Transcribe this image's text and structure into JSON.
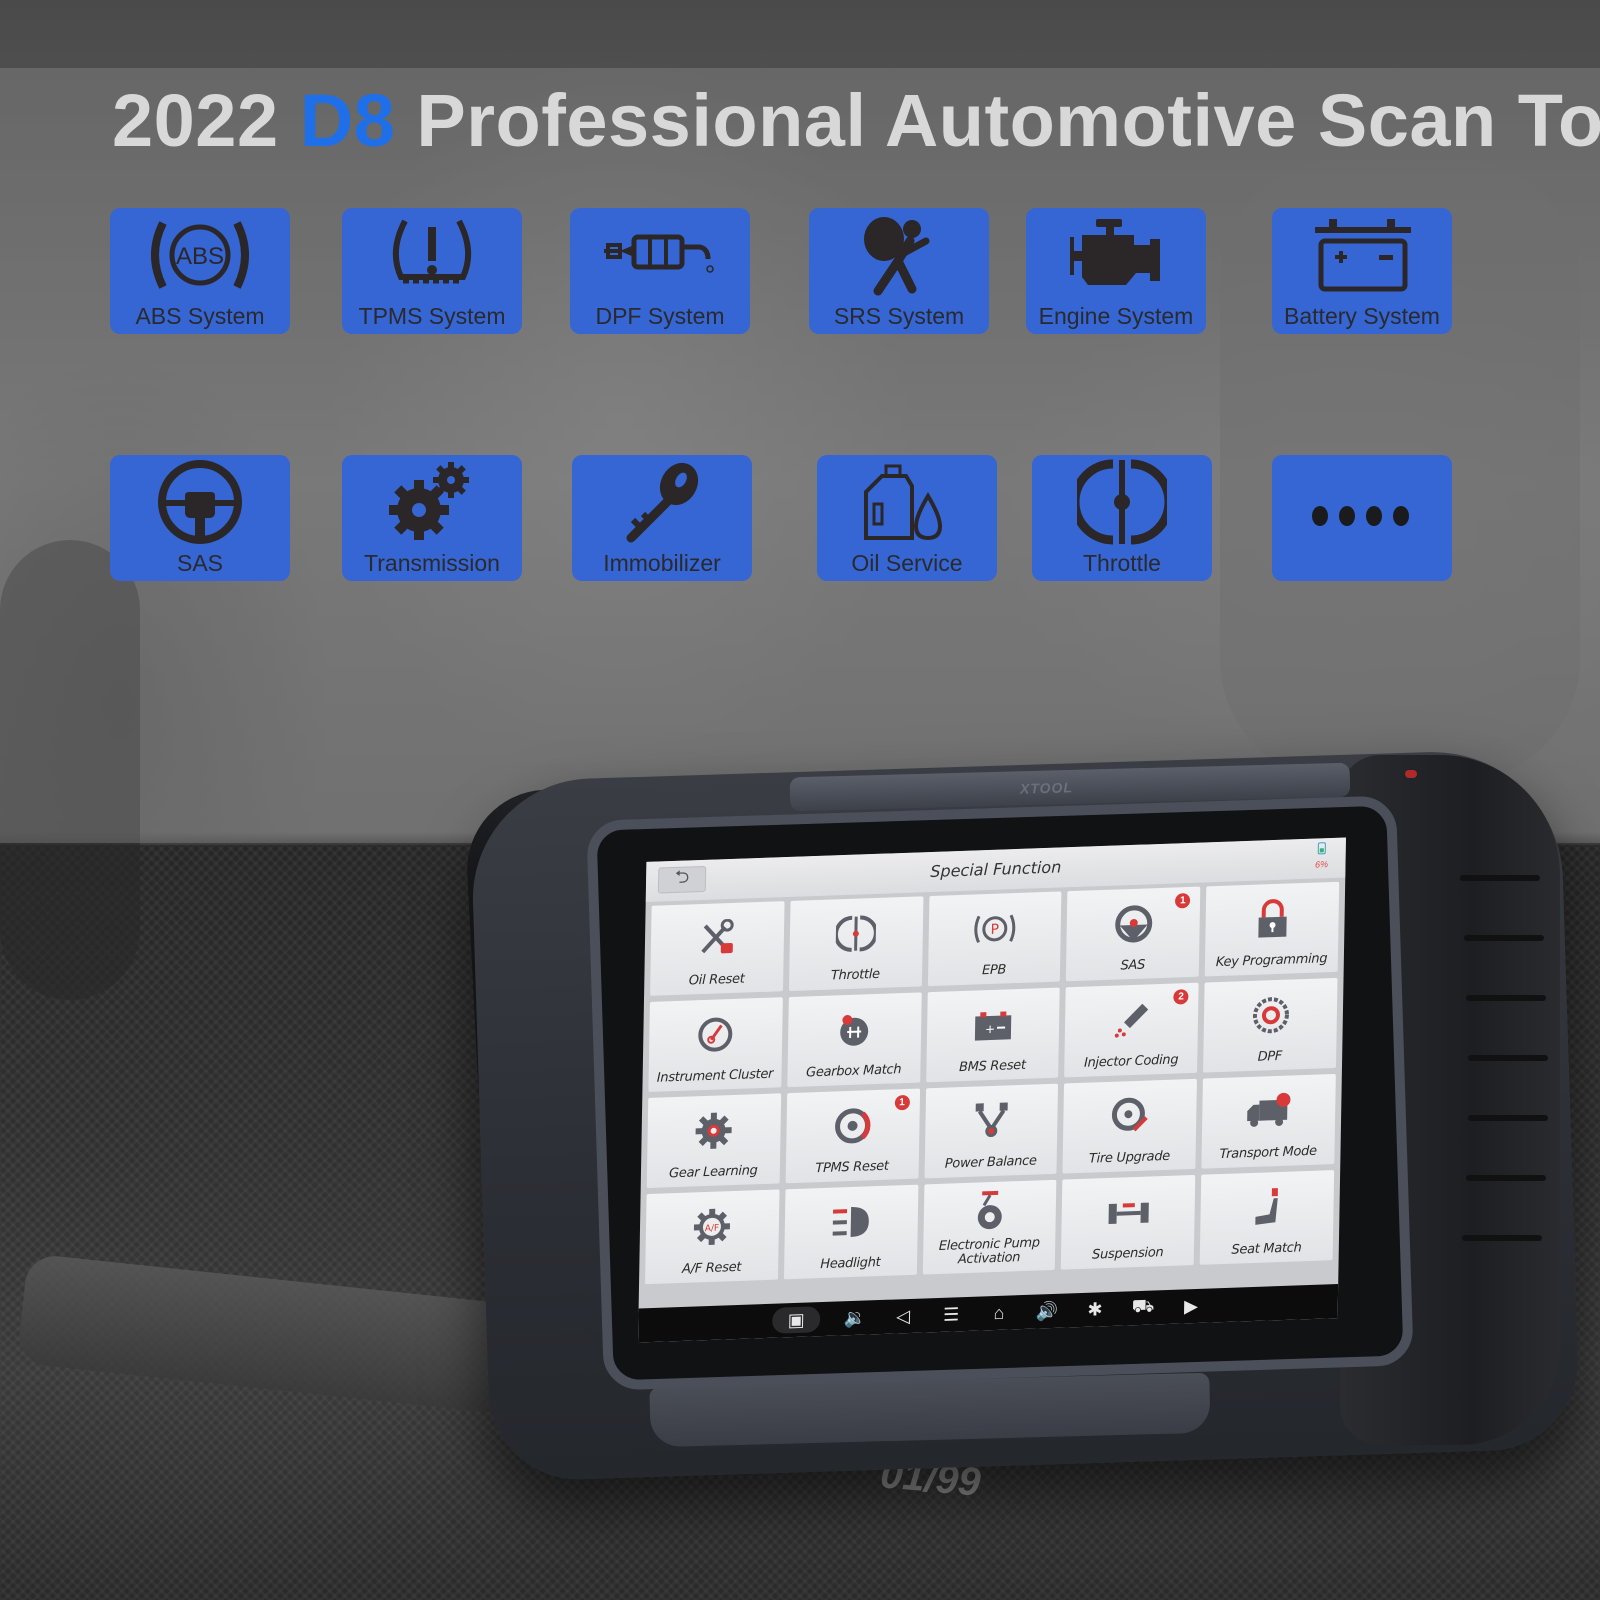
{
  "headline": {
    "year": "2022",
    "model": "D8",
    "rest": "Professional Automotive Scan Tool",
    "accent_color": "#1f6fe8",
    "text_color": "#d8d8d8"
  },
  "feature_tiles": {
    "tile_color": "#3566d3",
    "icon_color": "#2b2627",
    "row1": [
      {
        "label": "ABS System",
        "icon": "abs-icon"
      },
      {
        "label": "TPMS System",
        "icon": "tpms-icon"
      },
      {
        "label": "DPF System",
        "icon": "dpf-icon"
      },
      {
        "label": "SRS System",
        "icon": "airbag-icon"
      },
      {
        "label": "Engine System",
        "icon": "engine-icon"
      },
      {
        "label": "Battery System",
        "icon": "battery-icon"
      }
    ],
    "row2": [
      {
        "label": "SAS",
        "icon": "steering-wheel-icon"
      },
      {
        "label": "Transmission",
        "icon": "gears-icon"
      },
      {
        "label": "Immobilizer",
        "icon": "key-icon"
      },
      {
        "label": "Oil Service",
        "icon": "oil-can-icon"
      },
      {
        "label": "Throttle",
        "icon": "throttle-icon"
      },
      {
        "label": "",
        "icon": "more-dots-icon"
      }
    ]
  },
  "device": {
    "brand": "XTOOL",
    "sill_badge": "01/99",
    "screen": {
      "title": "Special Function",
      "back_icon": "back-arrow-icon",
      "battery_percent": "6%",
      "functions": [
        {
          "label": "Oil Reset",
          "icon": "wrench-icon",
          "badge": ""
        },
        {
          "label": "Throttle",
          "icon": "throttle-icon",
          "badge": ""
        },
        {
          "label": "EPB",
          "icon": "parking-brake-icon",
          "badge": ""
        },
        {
          "label": "SAS",
          "icon": "steering-wheel-icon",
          "badge": "1"
        },
        {
          "label": "Key Programming",
          "icon": "lock-icon",
          "badge": ""
        },
        {
          "label": "Instrument Cluster",
          "icon": "gauge-icon",
          "badge": ""
        },
        {
          "label": "Gearbox Match",
          "icon": "gear-shift-icon",
          "badge": ""
        },
        {
          "label": "BMS Reset",
          "icon": "battery-icon",
          "badge": ""
        },
        {
          "label": "Injector Coding",
          "icon": "injector-icon",
          "badge": "2"
        },
        {
          "label": "DPF",
          "icon": "dpf-filter-icon",
          "badge": ""
        },
        {
          "label": "Gear Learning",
          "icon": "gear-icon",
          "badge": ""
        },
        {
          "label": "TPMS Reset",
          "icon": "tire-icon",
          "badge": "1"
        },
        {
          "label": "Power Balance",
          "icon": "power-balance-icon",
          "badge": ""
        },
        {
          "label": "Tire Upgrade",
          "icon": "tire-wrench-icon",
          "badge": ""
        },
        {
          "label": "Transport Mode",
          "icon": "truck-icon",
          "badge": ""
        },
        {
          "label": "A/F Reset",
          "icon": "af-gear-icon",
          "badge": ""
        },
        {
          "label": "Headlight",
          "icon": "headlight-icon",
          "badge": ""
        },
        {
          "label": "Electronic Pump Activation",
          "icon": "pump-icon",
          "badge": ""
        },
        {
          "label": "Suspension",
          "icon": "suspension-icon",
          "badge": ""
        },
        {
          "label": "Seat Match",
          "icon": "seat-icon",
          "badge": ""
        }
      ],
      "navbar": [
        {
          "name": "screenshot-icon",
          "glyph": "▣",
          "active": true
        },
        {
          "name": "volume-down-icon",
          "glyph": "🔉"
        },
        {
          "name": "back-icon",
          "glyph": "◁"
        },
        {
          "name": "menu-icon",
          "glyph": "☰"
        },
        {
          "name": "home-icon",
          "glyph": "⌂"
        },
        {
          "name": "volume-up-icon",
          "glyph": "🔊"
        },
        {
          "name": "bluetooth-icon",
          "glyph": "✱"
        },
        {
          "name": "vci-car-icon",
          "glyph": "⛟"
        },
        {
          "name": "screen-record-icon",
          "glyph": "▶"
        }
      ]
    }
  }
}
